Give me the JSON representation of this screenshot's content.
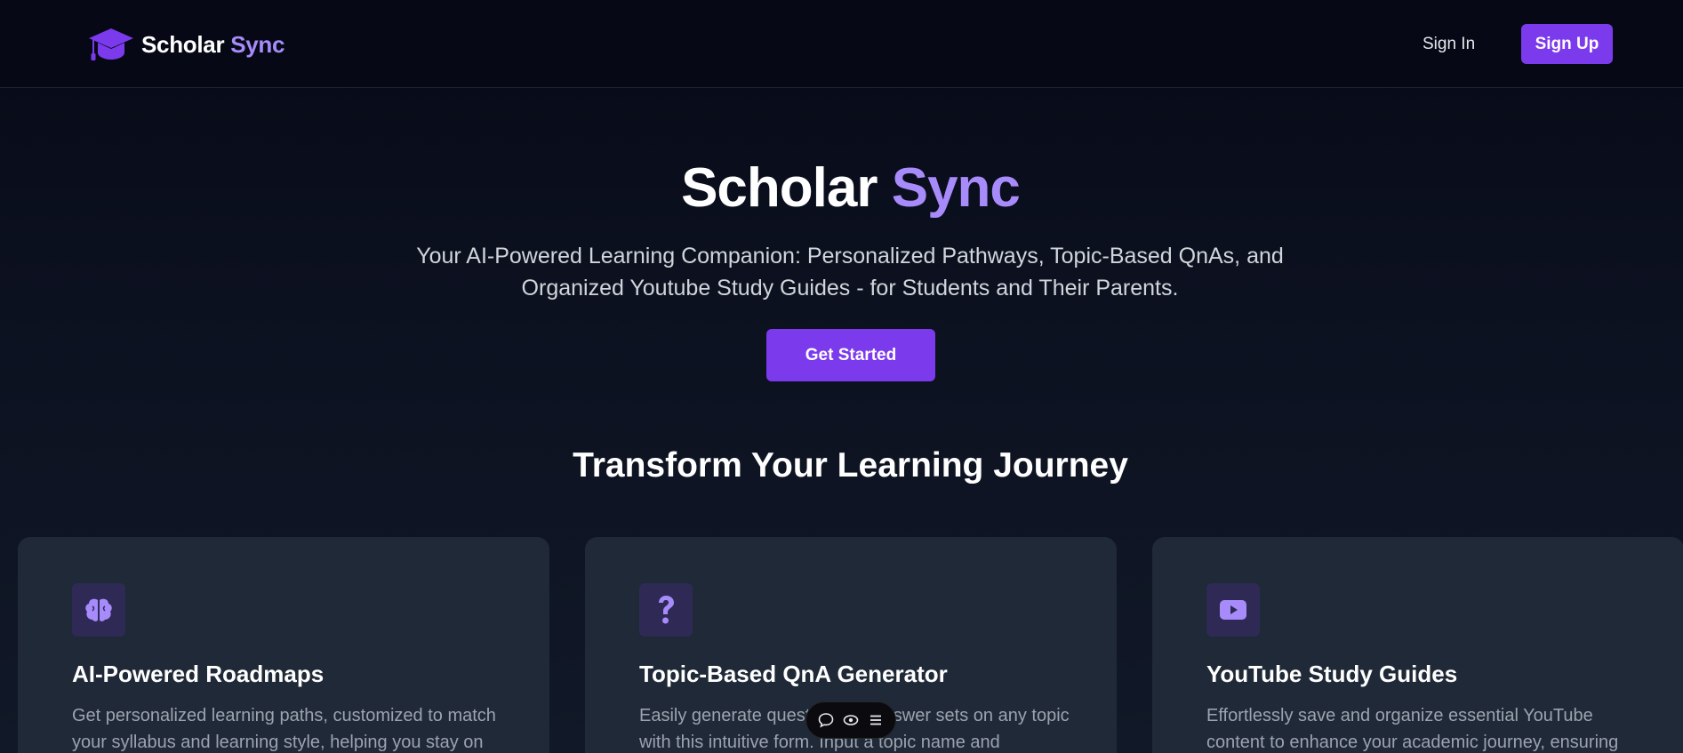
{
  "brand": {
    "name_main": "Scholar",
    "name_accent": "Sync",
    "icon": "graduation-cap-icon"
  },
  "nav": {
    "signin_label": "Sign In",
    "signup_label": "Sign Up"
  },
  "hero": {
    "title_main": "Scholar",
    "title_accent": "Sync",
    "subtitle_line1": "Your AI-Powered Learning Companion: Personalized Pathways, Topic-Based QnAs, and",
    "subtitle_line2": "Organized Youtube Study Guides - for Students and Their Parents.",
    "cta_label": "Get Started"
  },
  "features": {
    "title": "Transform Your Learning Journey",
    "cards": [
      {
        "icon": "brain-icon",
        "title": "AI-Powered Roadmaps",
        "desc": "Get personalized learning paths, customized to match your syllabus and learning style, helping you stay on"
      },
      {
        "icon": "question-mark-icon",
        "title": "Topic-Based QnA Generator",
        "desc": "Easily generate question and answer sets on any topic with this intuitive form. Input a topic name and"
      },
      {
        "icon": "youtube-play-icon",
        "title": "YouTube Study Guides",
        "desc": "Effortlessly save and organize essential YouTube content to enhance your academic journey, ensuring"
      }
    ]
  },
  "toolbar": {
    "icons": [
      "chat-bubble-icon",
      "eye-icon",
      "menu-icon"
    ]
  },
  "colors": {
    "accent": "#a78bfa",
    "primary": "#7c3aed",
    "card_bg": "#1f2937",
    "icon_bg": "#2e2a55"
  }
}
